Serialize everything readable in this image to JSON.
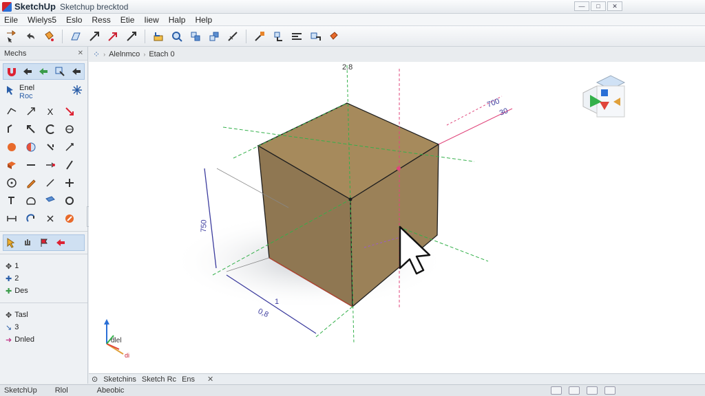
{
  "window": {
    "app_name": "SketchUp",
    "doc_title": "Sketchup brecktod",
    "controls": [
      "—",
      "□",
      "✕"
    ]
  },
  "menu": [
    "Eile",
    "Wielys5",
    "Eslo",
    "Ress",
    "Etie",
    "Iiew",
    "Halp",
    "Help"
  ],
  "toolbar": {
    "icons": [
      "select-arrow-icon",
      "undo-icon",
      "paint-bucket-icon",
      "line-tool-icon",
      "move-icon",
      "arrow-tool-icon",
      "push-pull-icon",
      "orbit-icon",
      "offset-icon",
      "rotate-icon",
      "scale-icon",
      "tape-measure-icon",
      "text-icon",
      "section-icon",
      "paint-icon"
    ]
  },
  "left_panel": {
    "title": "Mechs",
    "tool_select_primary": "Enel",
    "tool_select_secondary": "Roc",
    "layers": [
      {
        "label": "1",
        "icon": "move-icon"
      },
      {
        "label": "2",
        "icon": "cross-icon"
      },
      {
        "label": "Des",
        "icon": "plus-icon"
      }
    ],
    "bottom": [
      {
        "label": "Tasl",
        "icon": "tool-icon"
      },
      {
        "label": "3",
        "icon": "pin-icon"
      },
      {
        "label": "Dnled",
        "icon": "arrow-icon"
      }
    ]
  },
  "breadcrumb": {
    "items": [
      "Alelnmco",
      "Etach 0"
    ]
  },
  "viewport": {
    "dim_top": "2.8",
    "dim_right_a": "700",
    "dim_right_b": "30",
    "dim_left": "750",
    "dim_bottom_a": "1",
    "dim_bottom_b": "0,8",
    "axes_label_a": "dlel",
    "axes_label_b": "di"
  },
  "bottom_tabs": {
    "items": [
      "Sketchins",
      "Sketch Rc",
      "Ens"
    ],
    "close": "✕"
  },
  "status": {
    "left": "SketchUp",
    "mid": "Rlol",
    "right": "Abeobic"
  },
  "colors": {
    "cube_face": "#a08760",
    "cube_edge": "#1f1f1f",
    "axis_green": "#33b04a",
    "axis_red": "#e0457b",
    "dim_blue": "#3c3c9e"
  }
}
